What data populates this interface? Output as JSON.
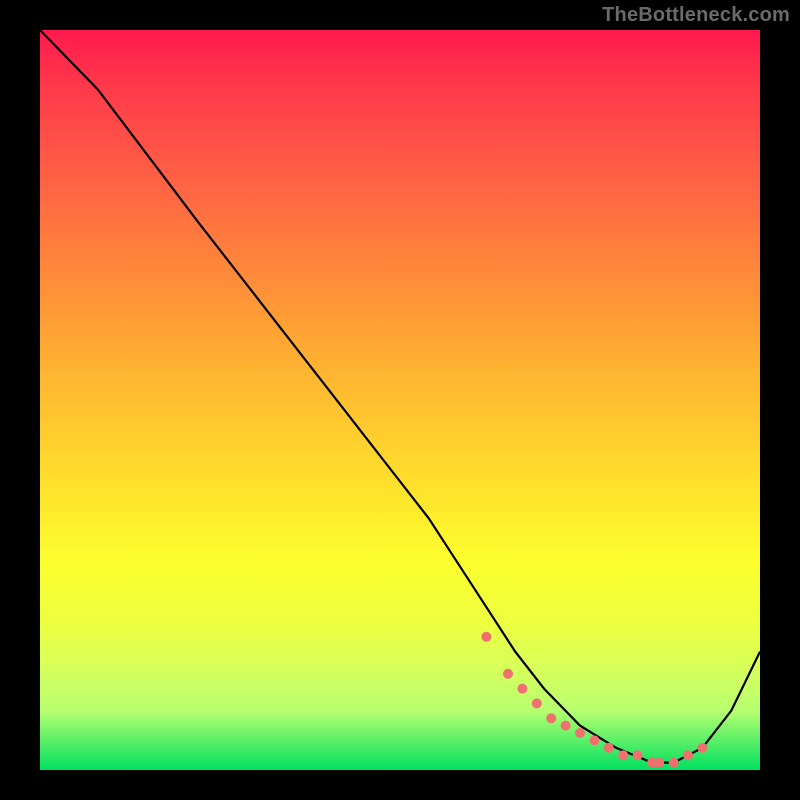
{
  "attribution": "TheBottleneck.com",
  "chart_data": {
    "type": "line",
    "title": "",
    "xlabel": "",
    "ylabel": "",
    "xlim": [
      0,
      100
    ],
    "ylim": [
      0,
      100
    ],
    "background_gradient": {
      "top": "#ff1a4d",
      "bottom": "#00e060"
    },
    "series": [
      {
        "name": "curve",
        "x": [
          0,
          8,
          15,
          22,
          30,
          38,
          46,
          54,
          58,
          62,
          66,
          70,
          75,
          80,
          85,
          88,
          92,
          96,
          100
        ],
        "y": [
          100,
          92,
          83,
          74,
          64,
          54,
          44,
          34,
          28,
          22,
          16,
          11,
          6,
          3,
          1,
          1,
          3,
          8,
          16
        ]
      }
    ],
    "markers": {
      "name": "dots",
      "color": "#f07070",
      "x": [
        62,
        65,
        67,
        69,
        71,
        73,
        75,
        77,
        79,
        81,
        83,
        85,
        86,
        88,
        90,
        92
      ],
      "y": [
        18,
        13,
        11,
        9,
        7,
        6,
        5,
        4,
        3,
        2,
        2,
        1,
        1,
        1,
        2,
        3
      ]
    }
  }
}
